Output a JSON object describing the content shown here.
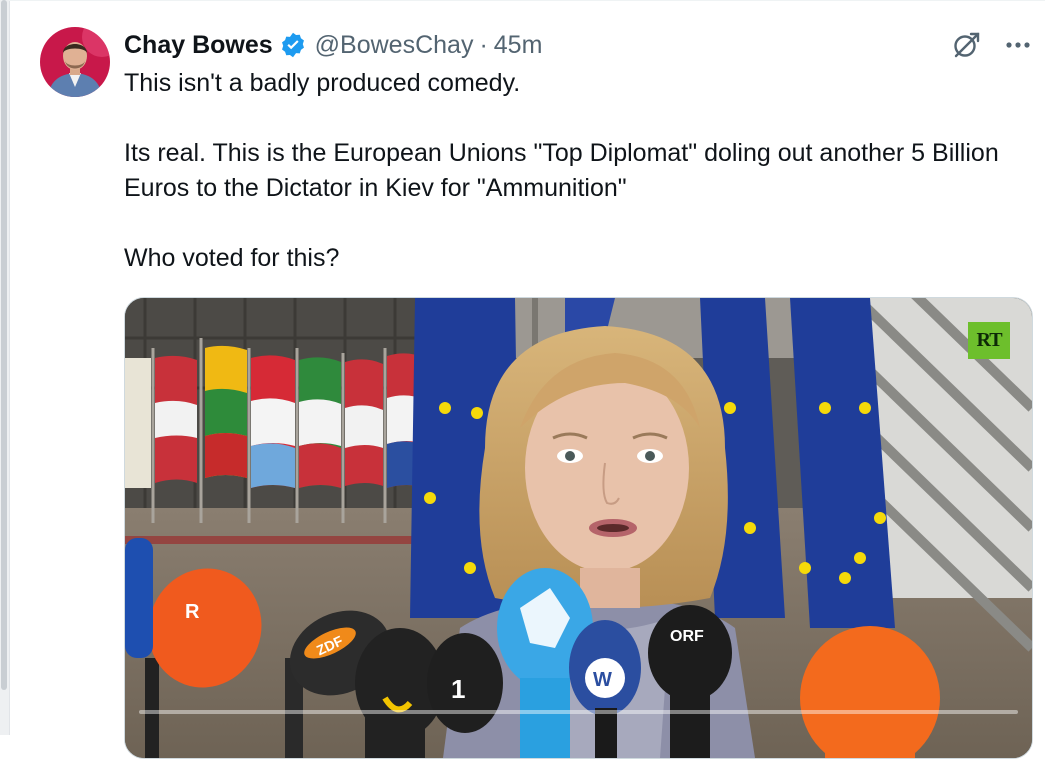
{
  "tweet": {
    "author_name": "Chay Bowes",
    "handle": "@BowesChay",
    "separator": "·",
    "time": "45m",
    "verified_color": "#1d9bf0",
    "text_lines": [
      "This isn't a badly produced comedy.",
      "",
      "Its real. This is the European Unions \"Top Diplomat\" doling out another 5 Billion Euros to the Dictator in Kiev for \"Ammunition\"",
      "",
      "Who voted for this?"
    ],
    "actions": {
      "grok_icon": "slashed-circle-icon",
      "more_icon": "more-dots-icon"
    }
  },
  "media": {
    "type": "video",
    "watermark": "RT",
    "mic_labels": {
      "zdf": "ZDF",
      "orf": "ORF",
      "dw": "W",
      "ard": "1"
    },
    "progress": 0.0
  }
}
